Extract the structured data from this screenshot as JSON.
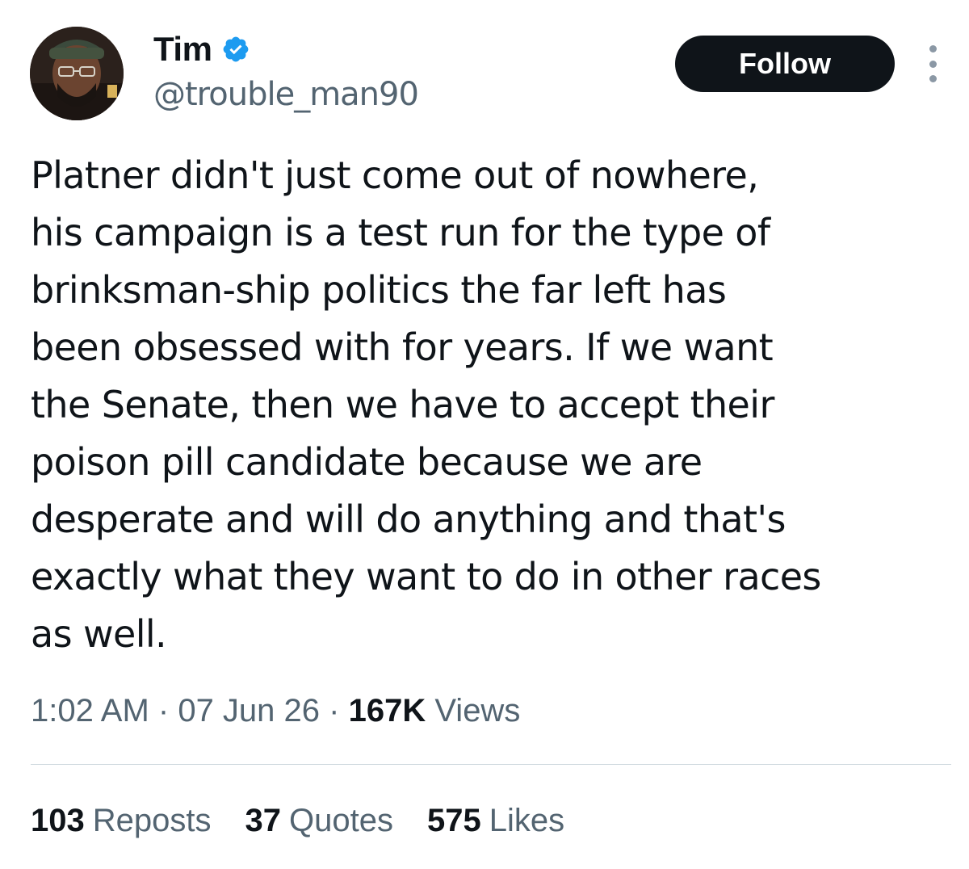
{
  "author": {
    "display_name": "Tim",
    "handle": "@trouble_man90",
    "verified_icon": "verified-badge-icon",
    "avatar_icon": "user-avatar"
  },
  "actions": {
    "follow_label": "Follow",
    "more_icon": "more-options-icon"
  },
  "tweet": {
    "lines": [
      "Platner didn't just come out of nowhere,",
      "his campaign is a test run for the type of",
      "brinksman-ship politics the far left has",
      "been obsessed with for years. If we want",
      "the Senate, then we have to accept their",
      "poison pill candidate because we are",
      "desperate and will do anything and that's",
      "exactly what they want to do in other races",
      "as well."
    ],
    "time": "1:02 AM",
    "date": "07 Jun 26",
    "separator": "·",
    "views_count": "167K",
    "views_label": "Views"
  },
  "stats": [
    {
      "count": "103",
      "label": "Reposts"
    },
    {
      "count": "37",
      "label": "Quotes"
    },
    {
      "count": "575",
      "label": "Likes"
    }
  ],
  "colors": {
    "text_primary": "#0f1419",
    "text_secondary": "#536471",
    "verified_blue": "#1d9bf0",
    "follow_bg": "#0f1419",
    "divider": "#cfd9de"
  }
}
